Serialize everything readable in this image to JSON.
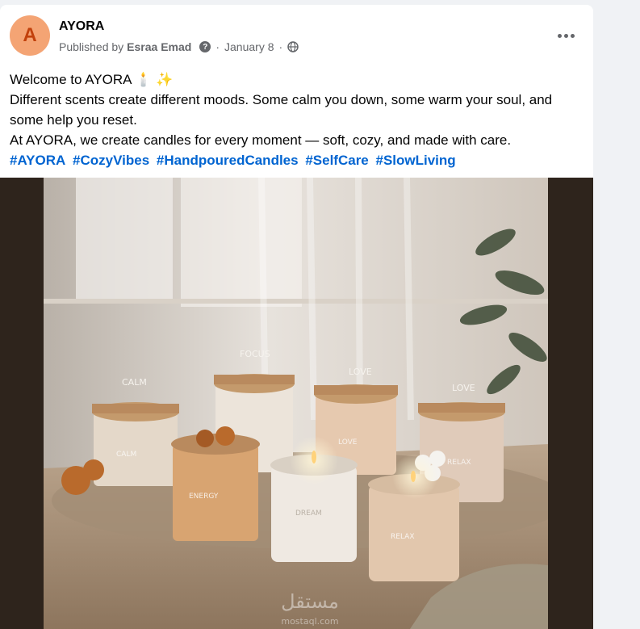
{
  "post": {
    "page_name": "AYORA",
    "avatar_letter": "A",
    "published_prefix": "Published by",
    "author": "Esraa Emad",
    "help_glyph": "?",
    "date": "January 8",
    "separator": "·",
    "audience_icon": "globe-icon",
    "more_icon": "more-horizontal-icon",
    "text_lines": [
      "Welcome to AYORA 🕯️ ✨",
      "Different scents create different moods. Some calm you down, some warm your soul, and some help you reset.",
      "At AYORA, we create candles for every moment — soft, cozy, and made with care."
    ],
    "hashtags": [
      "#AYORA",
      "#CozyVibes",
      "#HandpouredCandles",
      "#SelfCare",
      "#SlowLiving"
    ]
  },
  "image": {
    "candle_labels": [
      "CALM",
      "FOCUS",
      "LOVE",
      "LOVE",
      "ENERGY",
      "DREAM",
      "RELAX"
    ],
    "jar_text": [
      "CALM",
      "LOVE",
      "RELAX",
      "ENERGY",
      "DREAM",
      "RELAX"
    ],
    "watermark": "مستقل",
    "watermark_sub": "mostaql.com"
  },
  "colors": {
    "link": "#0064d1",
    "secondary_text": "#65676b",
    "avatar_bg": "#f4a474",
    "media_bg": "#2e241c"
  }
}
